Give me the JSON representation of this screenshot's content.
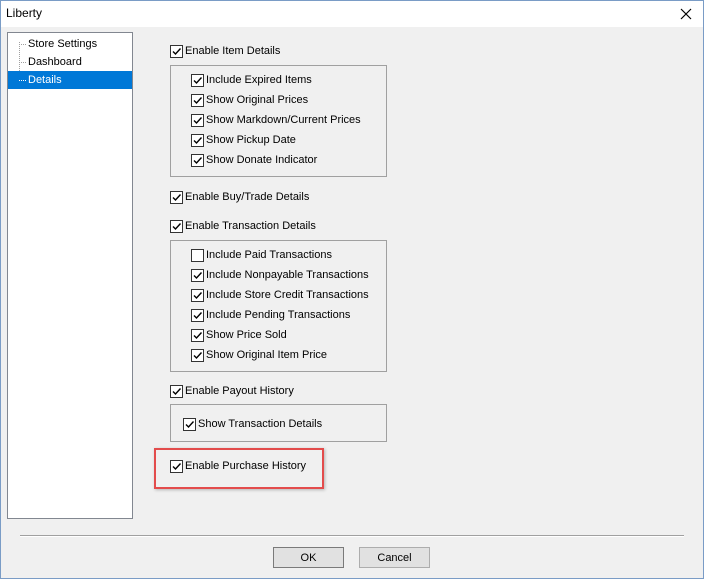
{
  "window": {
    "title": "Liberty"
  },
  "tree": {
    "items": [
      {
        "label": "Store Settings",
        "selected": false
      },
      {
        "label": "Dashboard",
        "selected": false
      },
      {
        "label": "Details",
        "selected": true
      }
    ]
  },
  "options": {
    "enable_item_details": {
      "label": "Enable Item Details",
      "checked": true
    },
    "item_details": [
      {
        "label": "Include Expired Items",
        "checked": true
      },
      {
        "label": "Show Original Prices",
        "checked": true
      },
      {
        "label": "Show Markdown/Current Prices",
        "checked": true
      },
      {
        "label": "Show Pickup Date",
        "checked": true
      },
      {
        "label": "Show Donate Indicator",
        "checked": true
      }
    ],
    "enable_buy_trade_details": {
      "label": "Enable Buy/Trade Details",
      "checked": true
    },
    "enable_transaction_details": {
      "label": "Enable Transaction Details",
      "checked": true
    },
    "transaction_details": [
      {
        "label": "Include Paid Transactions",
        "checked": false
      },
      {
        "label": "Include Nonpayable Transactions",
        "checked": true
      },
      {
        "label": "Include Store Credit Transactions",
        "checked": true
      },
      {
        "label": "Include Pending Transactions",
        "checked": true
      },
      {
        "label": "Show Price Sold",
        "checked": true
      },
      {
        "label": "Show Original Item Price",
        "checked": true
      }
    ],
    "enable_payout_history": {
      "label": "Enable Payout History",
      "checked": true
    },
    "payout_details": [
      {
        "label": "Show Transaction Details",
        "checked": true
      }
    ],
    "enable_purchase_history": {
      "label": "Enable Purchase History",
      "checked": true
    }
  },
  "buttons": {
    "ok": "OK",
    "cancel": "Cancel"
  },
  "colors": {
    "selection": "#0078d7",
    "highlight": "#e34c4c"
  }
}
